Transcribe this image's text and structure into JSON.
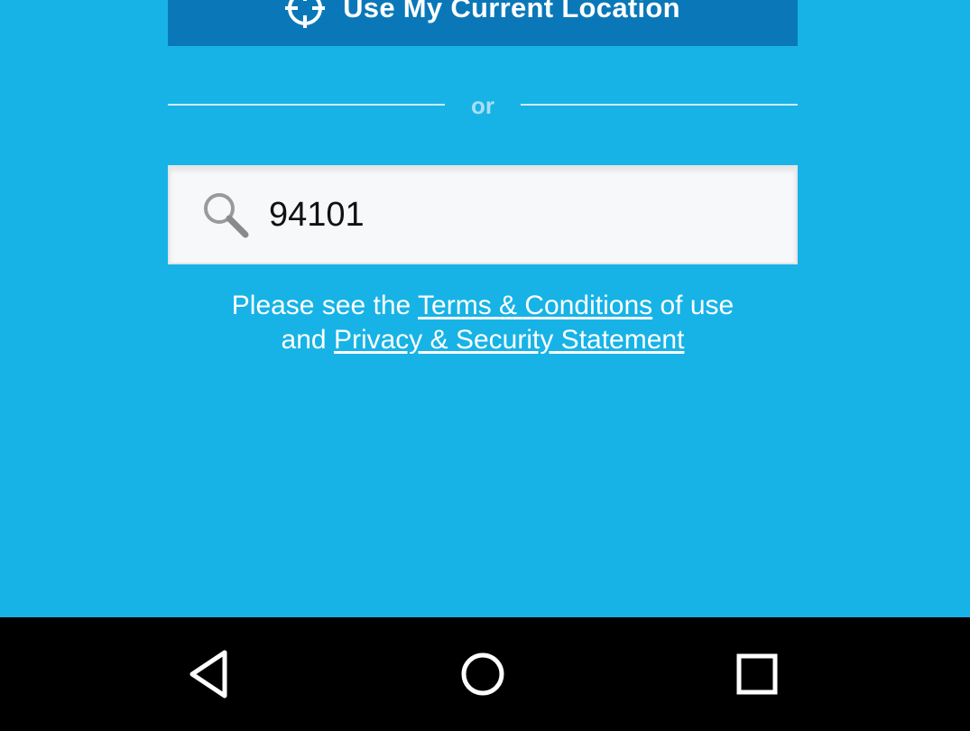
{
  "location_button": {
    "label": "Use My Current Location",
    "icon": "crosshair-icon",
    "color": "#0a78b8"
  },
  "divider": {
    "label": "or"
  },
  "search": {
    "value": "94101",
    "icon": "search-icon"
  },
  "legal": {
    "prefix": "Please see the",
    "terms_link": "Terms & Conditions",
    "middle": "of use",
    "and": "and",
    "privacy_link": "Privacy & Security Statement"
  },
  "nav_bar": {
    "back_icon": "back-triangle-icon",
    "home_icon": "home-circle-icon",
    "recents_icon": "recents-square-icon"
  },
  "colors": {
    "background": "#17b3e6",
    "nav_bar": "#000000"
  }
}
